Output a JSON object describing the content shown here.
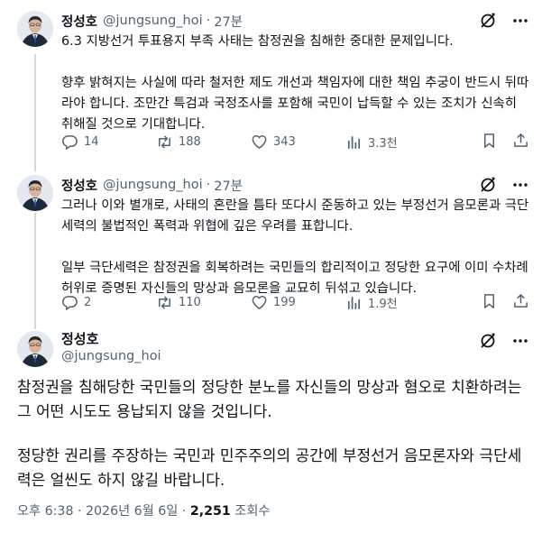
{
  "colors": {
    "text": "#0f1419",
    "muted": "#536471",
    "rail": "#cfd9de"
  },
  "posts": [
    {
      "name": "정성호",
      "handle": "@jungsung_hoi",
      "dot": "·",
      "time": "27분",
      "paragraphs": [
        "6.3 지방선거 투표용지 부족 사태는 참정권을 침해한 중대한 문제입니다.",
        "향후 밝혀지는 사실에 따라 철저한 제도 개선과 책임자에 대한 책임 추궁이 반드시 뒤따라야 합니다. 조만간 특검과 국정조사를 포함해 국민이 납득할 수 있는 조치가 신속히 취해질 것으로 기대합니다."
      ],
      "replies": "14",
      "reposts": "188",
      "likes": "343",
      "views": "3.3천"
    },
    {
      "name": "정성호",
      "handle": "@jungsung_hoi",
      "dot": "·",
      "time": "27분",
      "paragraphs": [
        "그러나 이와 별개로, 사태의 혼란을 틈타 또다시 준동하고 있는 부정선거 음모론과 극단세력의 불법적인 폭력과 위협에 깊은 우려를 표합니다.",
        "일부 극단세력은 참정권을 회복하려는 국민들의 합리적이고 정당한 요구에 이미 수차례 허위로 증명된 자신들의 망상과 음모론을 교묘히 뒤섞고 있습니다."
      ],
      "replies": "2",
      "reposts": "110",
      "likes": "199",
      "views": "1.9천"
    },
    {
      "name": "정성호",
      "handle": "@jungsung_hoi",
      "paragraphs": [
        "참정권을 침해당한 국민들의 정당한 분노를 자신들의 망상과 혐오로 치환하려는 그 어떤 시도도 용납되지 않을 것입니다.",
        "정당한 권리를 주장하는 국민과 민주주의의 공간에 부정선거 음모론자와 극단세력은 얼씬도 하지 않길 바랍니다."
      ],
      "timestamp": "오후 6:38 · 2026년 6월 6일 · ",
      "views_count": "2,251",
      "views_label": "조회수"
    }
  ]
}
